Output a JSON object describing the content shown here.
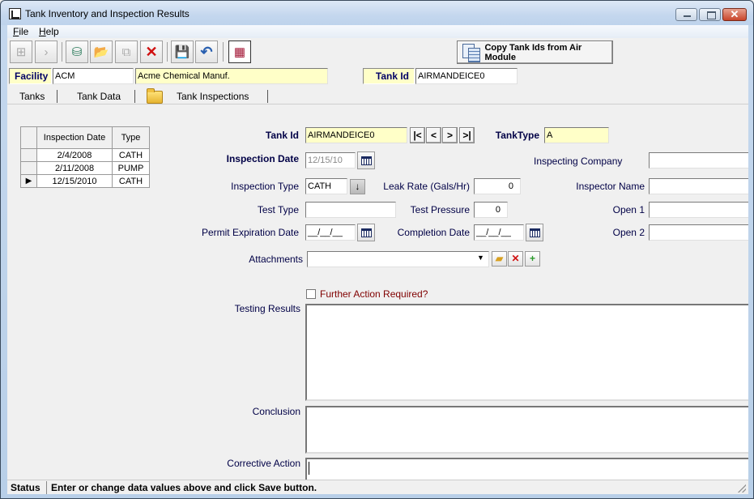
{
  "window": {
    "title": "Tank Inventory and Inspection Results",
    "controls": {
      "minimize": "minimize",
      "maximize": "maximize",
      "close": "✕"
    }
  },
  "menu": [
    {
      "label": "File",
      "accel": "F",
      "rest": "ile"
    },
    {
      "label": "Help",
      "accel": "H",
      "rest": "elp"
    }
  ],
  "toolbar": {
    "buttons": [
      {
        "name": "tree-view",
        "icon": "⊞"
      },
      {
        "name": "next",
        "icon": "›"
      },
      {
        "name": "database-add",
        "icon": "⛁"
      },
      {
        "name": "open-folder",
        "icon": "📂"
      },
      {
        "name": "copy",
        "icon": "⧉"
      },
      {
        "name": "delete",
        "icon": "✕"
      },
      {
        "name": "save",
        "icon": "💾"
      },
      {
        "name": "undo",
        "icon": "↶"
      },
      {
        "name": "calendar-grid",
        "icon": "▦"
      }
    ],
    "copy_button_label": "Copy Tank Ids from Air Module"
  },
  "header": {
    "facility_label": "Facility",
    "facility_code": "ACM",
    "facility_name": "Acme Chemical Manuf.",
    "tank_id_label": "Tank Id",
    "tank_id_value": "AIRMANDEICE0"
  },
  "tabs": [
    {
      "label": "Tanks",
      "active": false
    },
    {
      "label": "Tank Data",
      "active": false
    },
    {
      "label": "Tank Inspections",
      "active": true
    }
  ],
  "inspections_grid": {
    "columns": [
      "Inspection Date",
      "Type"
    ],
    "rows": [
      {
        "date": "2/4/2008",
        "type": "CATH",
        "selected": false
      },
      {
        "date": "2/11/2008",
        "type": "PUMP",
        "selected": false
      },
      {
        "date": "12/15/2010",
        "type": "CATH",
        "selected": true
      }
    ],
    "row_indicator": "▶"
  },
  "form": {
    "tank_id": {
      "label": "Tank Id",
      "value": "AIRMANDEICE0"
    },
    "nav": {
      "first": "|<",
      "prev": "<",
      "next": ">",
      "last": ">|"
    },
    "tank_type": {
      "label": "TankType",
      "value": "A"
    },
    "inspection_date": {
      "label": "Inspection Date",
      "value": "12/15/10"
    },
    "inspecting_company": {
      "label": "Inspecting Company",
      "value": ""
    },
    "inspection_type": {
      "label": "Inspection Type",
      "value": "CATH"
    },
    "leak_rate": {
      "label": "Leak Rate (Gals/Hr)",
      "value": "0"
    },
    "inspector_name": {
      "label": "Inspector Name",
      "value": ""
    },
    "test_type": {
      "label": "Test Type",
      "value": ""
    },
    "test_pressure": {
      "label": "Test Pressure",
      "value": "0"
    },
    "open1": {
      "label": "Open 1",
      "value": ""
    },
    "permit_expiration_date": {
      "label": "Permit Expiration Date",
      "value": "__/__/__"
    },
    "completion_date": {
      "label": "Completion Date",
      "value": "__/__/__"
    },
    "open2": {
      "label": "Open 2",
      "value": ""
    },
    "attachments": {
      "label": "Attachments",
      "value": ""
    },
    "further_action": {
      "label": "Further Action Required?",
      "checked": false
    },
    "testing_results": {
      "label": "Testing Results",
      "value": ""
    },
    "conclusion": {
      "label": "Conclusion",
      "value": ""
    },
    "corrective_action": {
      "label": "Corrective Action",
      "value": ""
    }
  },
  "status": {
    "label": "Status",
    "message": "Enter or change data values above and click Save button."
  },
  "colors": {
    "highlight_yellow": "#ffffc8",
    "label_navy": "#000066",
    "further_action_red": "#800000"
  }
}
